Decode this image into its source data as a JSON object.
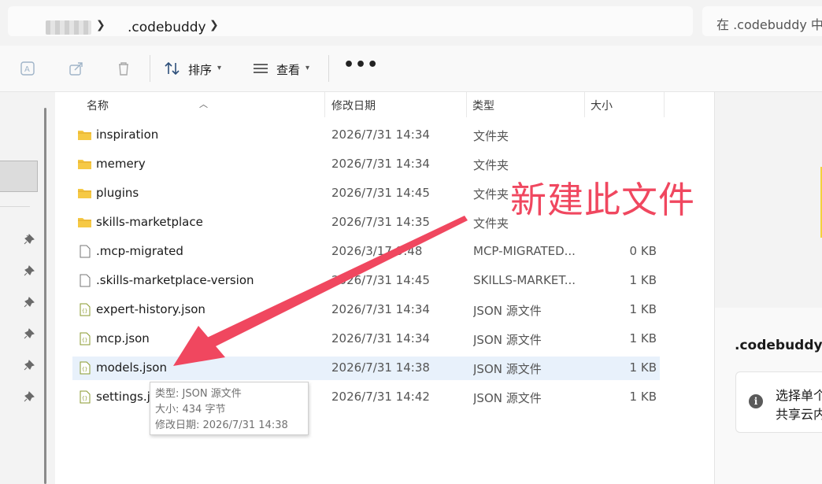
{
  "address_bar": {
    "breadcrumb_current": ".codebuddy",
    "search_placeholder": "在 .codebuddy 中"
  },
  "toolbar": {
    "sort_label": "排序",
    "view_label": "查看",
    "more_label": "•••"
  },
  "columns": {
    "name": "名称",
    "date": "修改日期",
    "type": "类型",
    "size": "大小"
  },
  "files": [
    {
      "name": "inspiration",
      "date": "2026/7/31 14:34",
      "type": "文件夹",
      "size": "",
      "icon": "folder-icon"
    },
    {
      "name": "memery",
      "date": "2026/7/31 14:34",
      "type": "文件夹",
      "size": "",
      "icon": "folder-icon"
    },
    {
      "name": "plugins",
      "date": "2026/7/31 14:45",
      "type": "文件夹",
      "size": "",
      "icon": "folder-icon"
    },
    {
      "name": "skills-marketplace",
      "date": "2026/7/31 14:35",
      "type": "文件夹",
      "size": "",
      "icon": "folder-icon"
    },
    {
      "name": ".mcp-migrated",
      "date": "2026/3/17 9:48",
      "type": "MCP-MIGRATED...",
      "size": "0 KB",
      "icon": "file-icon"
    },
    {
      "name": ".skills-marketplace-version",
      "date": "2026/7/31 14:45",
      "type": "SKILLS-MARKET...",
      "size": "1 KB",
      "icon": "file-icon"
    },
    {
      "name": "expert-history.json",
      "date": "2026/7/31 14:34",
      "type": "JSON 源文件",
      "size": "1 KB",
      "icon": "json-file-icon"
    },
    {
      "name": "mcp.json",
      "date": "2026/7/31 14:34",
      "type": "JSON 源文件",
      "size": "1 KB",
      "icon": "json-file-icon"
    },
    {
      "name": "models.json",
      "date": "2026/7/31 14:38",
      "type": "JSON 源文件",
      "size": "1 KB",
      "icon": "json-file-icon",
      "highlighted": true
    },
    {
      "name": "settings.json",
      "date": "2026/7/31 14:42",
      "type": "JSON 源文件",
      "size": "1 KB",
      "icon": "json-file-icon"
    }
  ],
  "tooltip": {
    "type_line": "类型: JSON 源文件",
    "size_line": "大小: 434 字节",
    "date_line": "修改日期: 2026/7/31 14:38"
  },
  "details_pane": {
    "title": ".codebuddy",
    "info_line1": "选择单个",
    "info_line2": "共享云内"
  },
  "annotation": {
    "text": "新建此文件",
    "color": "#f0475f"
  },
  "colors": {
    "highlight_row": "#e8f1fb",
    "folder": "#f6c945",
    "json_icon": "#8a9a2e"
  }
}
